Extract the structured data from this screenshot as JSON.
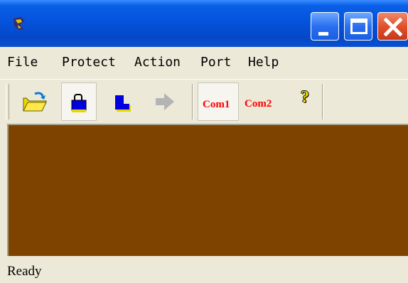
{
  "window": {
    "title": "",
    "buttons": {
      "minimize": "minimize-icon",
      "maximize": "maximize-icon",
      "close": "close-icon"
    }
  },
  "menu": [
    {
      "label": "File"
    },
    {
      "label": "Protect"
    },
    {
      "label": "Action"
    },
    {
      "label": "Port"
    },
    {
      "label": "Help"
    }
  ],
  "toolbar": {
    "buttons": [
      {
        "icon": "open-folder-icon",
        "pressed": false
      },
      {
        "icon": "lock-icon",
        "pressed": true
      },
      {
        "icon": "unlock-icon",
        "pressed": false
      },
      {
        "icon": "forward-arrow-icon",
        "pressed": false,
        "disabled": true
      },
      {
        "label": "Com1",
        "pressed": true
      },
      {
        "label": "Com2",
        "pressed": false
      },
      {
        "icon": "help-icon",
        "label": "?",
        "pressed": false
      }
    ]
  },
  "colors": {
    "title_bar": "#0553dc",
    "client_background": "#7f4300",
    "com_label": "#ff0000",
    "window_face": "#ece9d8"
  },
  "status": {
    "text": "Ready"
  }
}
